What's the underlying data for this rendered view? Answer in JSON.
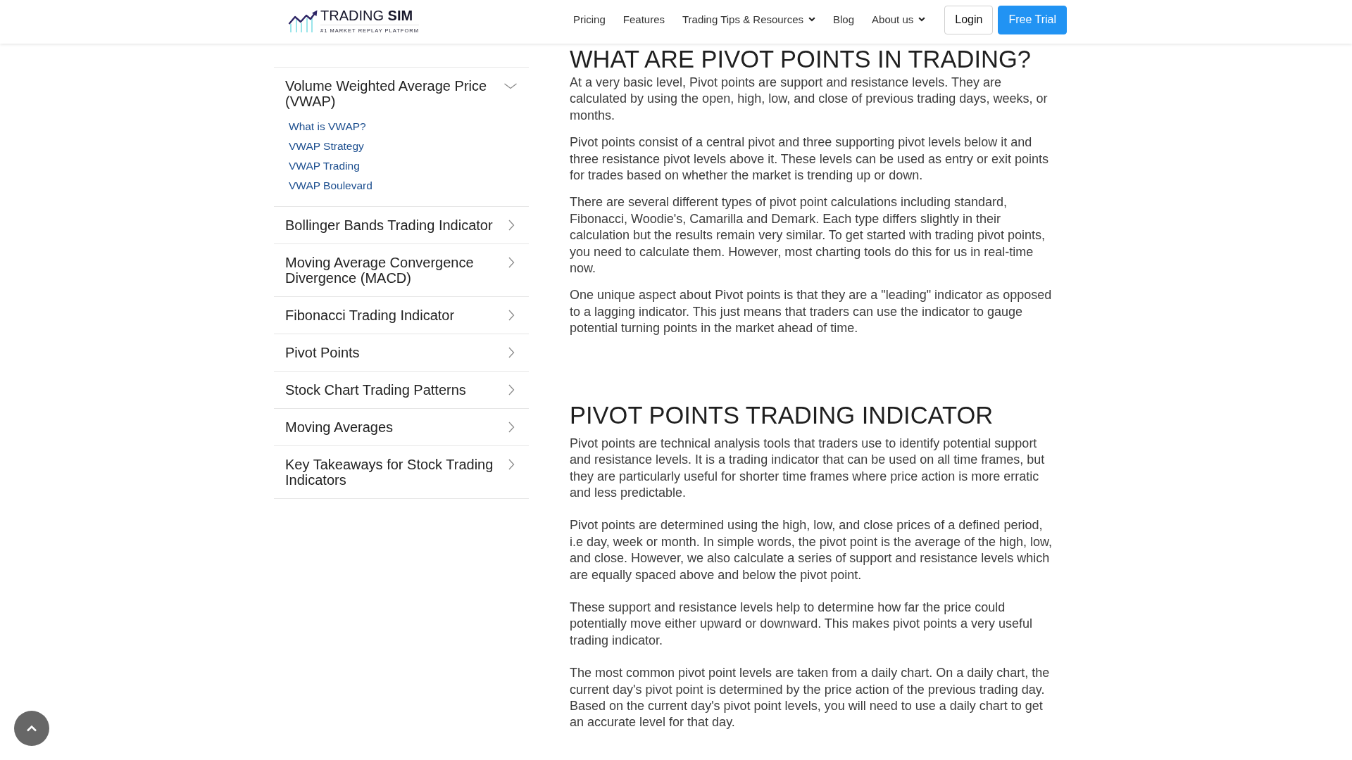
{
  "header": {
    "logo": {
      "name": "TRADING **SIM**",
      "tagline": "#1 MARKET REPLAY PLATFORM"
    },
    "nav": [
      {
        "label": "Pricing",
        "dropdown": false
      },
      {
        "label": "Features",
        "dropdown": false
      },
      {
        "label": "Trading Tips & Resources",
        "dropdown": true
      },
      {
        "label": "Blog",
        "dropdown": false
      },
      {
        "label": "About us",
        "dropdown": true
      }
    ],
    "buttons": [
      {
        "label": "Login",
        "kind": "outline"
      },
      {
        "label": "Free Trial",
        "kind": "primary"
      }
    ]
  },
  "sidebar": {
    "items": [
      {
        "label": "Volume Weighted Average Price (VWAP)",
        "expanded": true,
        "children": [
          {
            "label": "What is VWAP?"
          },
          {
            "label": "VWAP Strategy"
          },
          {
            "label": "VWAP Trading"
          },
          {
            "label": "VWAP Boulevard"
          }
        ]
      },
      {
        "label": "Bollinger Bands Trading Indicator",
        "expanded": false
      },
      {
        "label": "Moving Average Convergence Divergence (MACD)",
        "expanded": false
      },
      {
        "label": "Fibonacci Trading Indicator",
        "expanded": false
      },
      {
        "label": "Pivot Points",
        "expanded": false
      },
      {
        "label": "Stock Chart Trading Patterns",
        "expanded": false
      },
      {
        "label": "Moving Averages",
        "expanded": false
      },
      {
        "label": "Key Takeaways for Stock Trading Indicators",
        "expanded": false
      }
    ]
  },
  "article": {
    "sections": [
      {
        "heading": "WHAT ARE PIVOT POINTS IN TRADING?",
        "paragraphs": [
          "At a very basic level, Pivot points are support and resistance levels. They are calculated by using the open, high, low, and close of previous trading days, weeks, or months.",
          "Pivot points consist of a central pivot and three supporting pivot levels below it and three resistance pivot levels above it. These levels can be used as entry or exit points for trades based on whether the market is trending up or down.",
          "There are several different types of pivot point calculations including standard, Fibonacci, Woodie's, Camarilla and Demark. Each type differs slightly in their calculation but the results remain very similar. To get started with trading pivot points, you need to calculate them. However, most charting tools do this for us in real-time now.",
          "One unique aspect about Pivot points is that they are a \"leading\" indicator as opposed to a lagging indicator. This just means that traders can use the indicator to gauge potential turning points in the market ahead of time."
        ]
      },
      {
        "heading": "PIVOT POINTS TRADING INDICATOR",
        "paragraphs": [
          "Pivot points are technical analysis tools that traders use to identify potential support and resistance levels. It is a trading indicator that can be used on all time frames, but they are particularly useful for shorter time frames where price action is more erratic and less predictable.",
          "Pivot points are determined using the high, low, and close prices of a defined period, i.e day, week or month. In simple words, the pivot point is the average of the high, low, and close. However, we also calculate a series of support and resistance levels which are equally spaced above and below the pivot point.",
          "These support and resistance levels help to determine how far the price could potentially move either upward or downward. This makes pivot points a very useful trading indicator.",
          "The most common pivot point levels are taken from a daily chart. On a daily chart, the current day's pivot point is determined by the price action of the previous trading day. Based on the current day's pivot point levels, you will need to use a daily chart to get an accurate level for that day."
        ]
      }
    ]
  }
}
